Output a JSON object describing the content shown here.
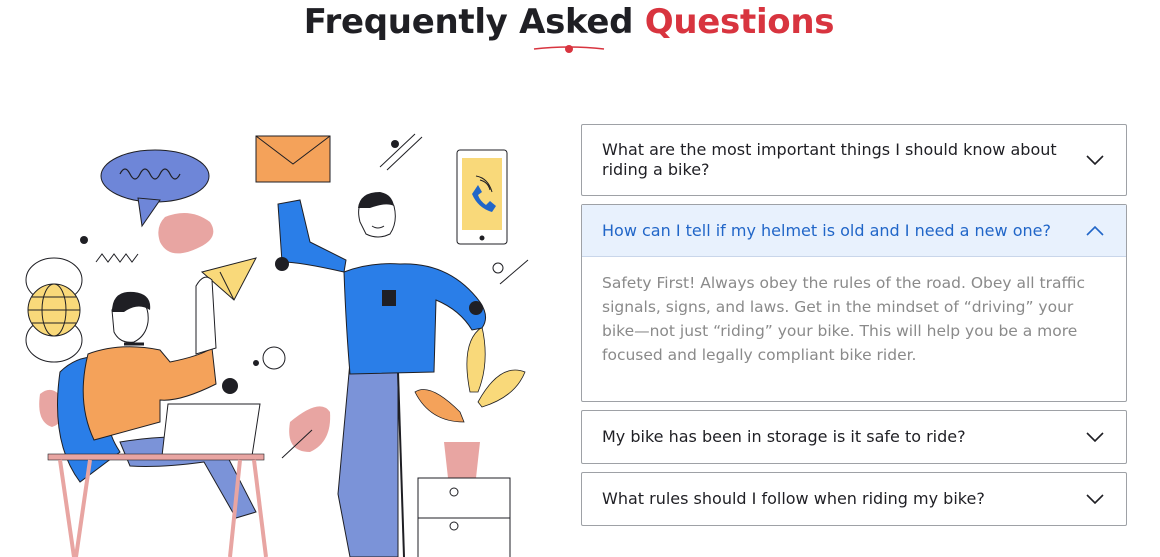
{
  "header": {
    "title_part1": "Frequently Asked",
    "title_part2": "Questions"
  },
  "illustration": {
    "description_icon": "people-with-messages-illustration"
  },
  "faq": {
    "items": [
      {
        "question": "What are the most important things I should know about riding a bike?",
        "expanded": false,
        "chevron": "chevron-down-icon"
      },
      {
        "question": "How can I tell if my helmet is old and I need a new one?",
        "expanded": true,
        "chevron": "chevron-up-icon",
        "answer": "Safety First! Always obey the rules of the road. Obey all traffic signals, signs, and laws. Get in the mindset of “driving” your bike—not just “riding” your bike. This will help you be a more focused and legally compliant bike rider."
      },
      {
        "question": "My bike has been in storage is it safe to ride?",
        "expanded": false,
        "chevron": "chevron-down-icon"
      },
      {
        "question": "What rules should I follow when riding my bike?",
        "expanded": false,
        "chevron": "chevron-down-icon"
      }
    ]
  },
  "colors": {
    "accent_red": "#d8343f",
    "active_blue": "#2166c8",
    "active_bg": "#e8f1fd"
  }
}
